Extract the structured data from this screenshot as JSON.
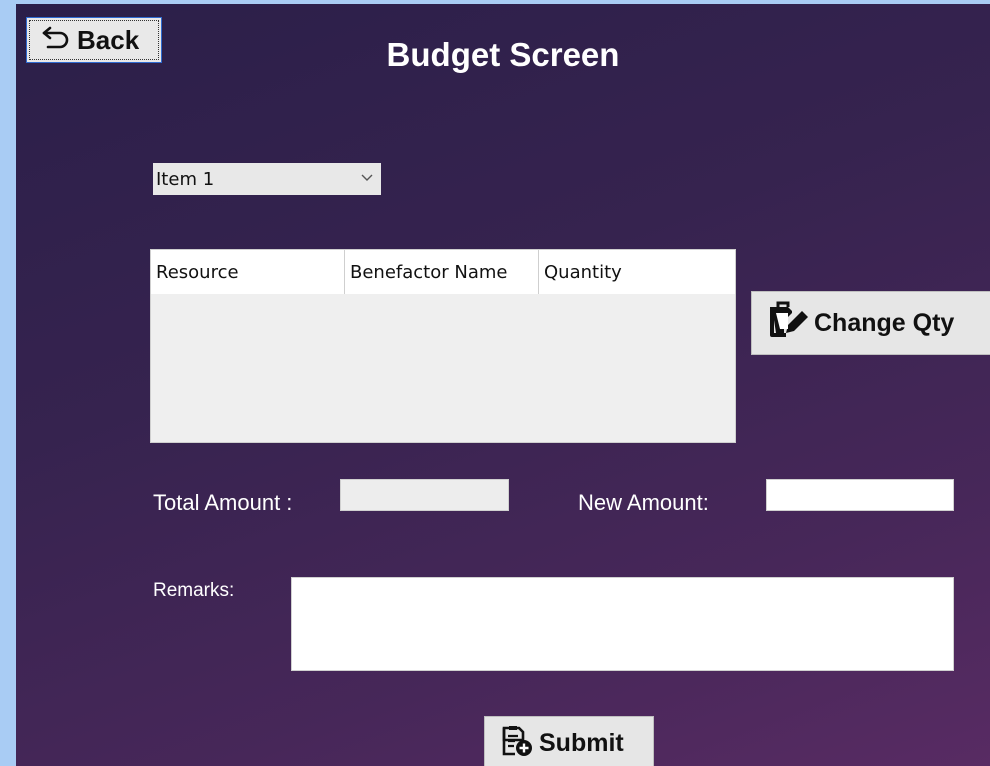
{
  "window": {
    "title": "Budget Screen"
  },
  "toolbar": {
    "back_label": "Back",
    "back_icon": "undo-arrow-icon"
  },
  "filter": {
    "selected": "Item 1"
  },
  "grid": {
    "columns": [
      "Resource",
      "Benefactor Name",
      "Quantity"
    ],
    "rows": []
  },
  "actions": {
    "change_qty_label": "Change Qty",
    "change_qty_icon": "edit-document-icon",
    "submit_label": "Submit",
    "submit_icon": "add-document-icon"
  },
  "form": {
    "total_amount_label": "Total Amount :",
    "total_amount_value": "",
    "new_amount_label": "New Amount:",
    "new_amount_value": "",
    "remarks_label": "Remarks:",
    "remarks_value": ""
  }
}
